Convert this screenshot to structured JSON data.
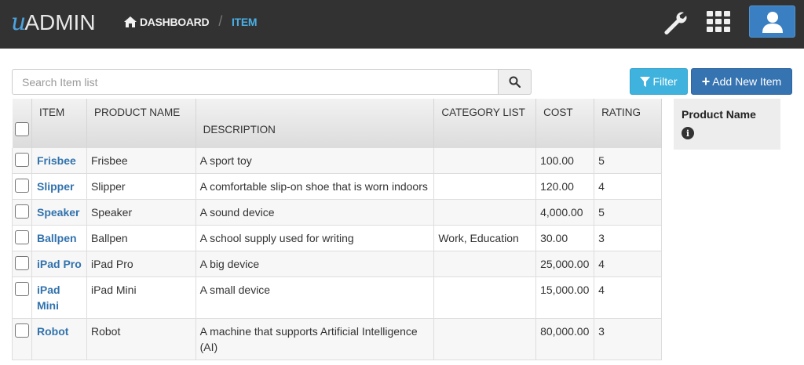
{
  "app": {
    "logo_mark": "u",
    "logo_text": "ADMIN"
  },
  "breadcrumb": {
    "home_label": "DASHBOARD",
    "separator": "/",
    "current": "ITEM"
  },
  "topbar": {
    "settings_icon": "wrench-icon",
    "apps_icon": "grid-icon",
    "user_icon": "user-icon"
  },
  "search": {
    "placeholder": "Search Item list",
    "value": ""
  },
  "actions": {
    "filter_label": "Filter",
    "add_label": "Add New Item"
  },
  "table": {
    "headers": [
      "ITEM",
      "PRODUCT NAME",
      "DESCRIPTION",
      "CATEGORY LIST",
      "COST",
      "RATING"
    ],
    "rows": [
      {
        "item": "Frisbee",
        "product": "Frisbee",
        "description": "A sport toy",
        "category": "",
        "cost": "100.00",
        "rating": "5"
      },
      {
        "item": "Slipper",
        "product": "Slipper",
        "description": "A comfortable slip-on shoe that is worn indoors",
        "category": "",
        "cost": "120.00",
        "rating": "4"
      },
      {
        "item": "Speaker",
        "product": "Speaker",
        "description": "A sound device",
        "category": "",
        "cost": "4,000.00",
        "rating": "5"
      },
      {
        "item": "Ballpen",
        "product": "Ballpen",
        "description": "A school supply used for writing",
        "category": "Work, Education",
        "cost": "30.00",
        "rating": "3"
      },
      {
        "item": "iPad Pro",
        "product": "iPad Pro",
        "description": "A big device",
        "category": "",
        "cost": "25,000.00",
        "rating": "4"
      },
      {
        "item": "iPad Mini",
        "product": "iPad Mini",
        "description": "A small device",
        "category": "",
        "cost": "15,000.00",
        "rating": "4"
      },
      {
        "item": "Robot",
        "product": "Robot",
        "description": "A machine that supports Artificial Intelligence (AI)",
        "category": "",
        "cost": "80,000.00",
        "rating": "3"
      }
    ]
  },
  "side_panel": {
    "title": "Product Name",
    "info_icon": "info-icon"
  },
  "colors": {
    "topbar": "#323232",
    "accent": "#4ab0e6",
    "link": "#3172ad",
    "filter_button": "#3fb3de",
    "add_button": "#3673b1",
    "user_button": "#3a7fc2"
  }
}
